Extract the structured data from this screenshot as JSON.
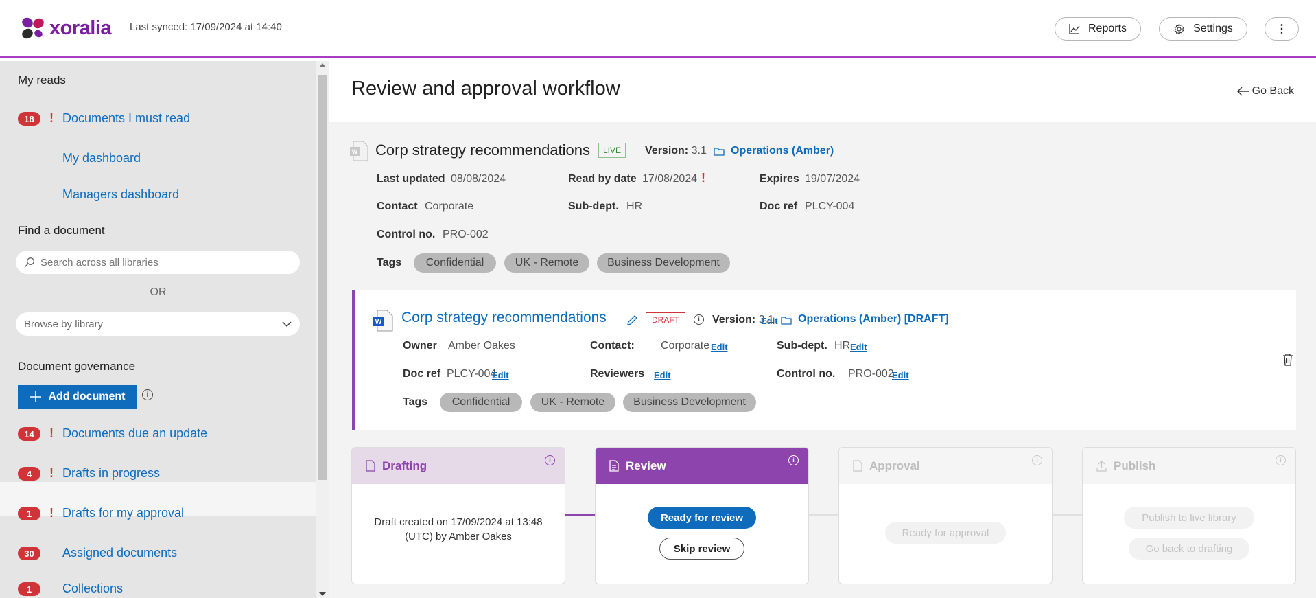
{
  "app": {
    "brand": "xoralia",
    "last_synced": "Last synced: 17/09/2024 at 14:40"
  },
  "header": {
    "reports_label": "Reports",
    "settings_label": "Settings",
    "more_label": "⋮"
  },
  "sidebar": {
    "my_reads_heading": "My reads",
    "documents_must_read": {
      "count": "18",
      "label": "Documents I must read"
    },
    "my_dashboard": "My dashboard",
    "managers_dashboard": "Managers dashboard",
    "find_heading": "Find a document",
    "search_placeholder": "Search across all libraries",
    "or_label": "OR",
    "browse_label": "Browse by library",
    "governance_heading": "Document governance",
    "add_document": "Add document",
    "items": [
      {
        "count": "14",
        "label": "Documents due an update",
        "alert": true
      },
      {
        "count": "4",
        "label": "Drafts in progress",
        "alert": true
      },
      {
        "count": "1",
        "label": "Drafts for my approval",
        "alert": true
      },
      {
        "count": "30",
        "label": "Assigned documents",
        "alert": false
      },
      {
        "count": "1",
        "label": "Collections",
        "alert": false
      }
    ]
  },
  "page": {
    "title": "Review and approval workflow",
    "go_back": "Go Back"
  },
  "live_doc": {
    "name": "Corp strategy recommendations",
    "status": "LIVE",
    "version_label": "Version:",
    "version": "3.1",
    "library": "Operations (Amber)",
    "last_updated_label": "Last updated",
    "last_updated": "08/08/2024",
    "read_by_label": "Read by date",
    "read_by": "17/08/2024",
    "expires_label": "Expires",
    "expires": "19/07/2024",
    "contact_label": "Contact",
    "contact": "Corporate",
    "subdept_label": "Sub-dept.",
    "subdept": "HR",
    "docref_label": "Doc ref",
    "docref": "PLCY-004",
    "control_label": "Control no.",
    "control": "PRO-002",
    "tags_label": "Tags",
    "tags": [
      "Confidential",
      "UK - Remote",
      "Business Development"
    ]
  },
  "draft_doc": {
    "name": "Corp strategy recommendations",
    "status": "DRAFT",
    "version_label": "Version:",
    "version": "3.1",
    "edit": "Edit",
    "library": "Operations (Amber) [DRAFT]",
    "owner_label": "Owner",
    "owner": "Amber Oakes",
    "contact_label": "Contact:",
    "contact": "Corporate",
    "subdept_label": "Sub-dept.",
    "subdept": "HR",
    "docref_label": "Doc ref",
    "docref": "PLCY-004",
    "reviewers_label": "Reviewers",
    "control_label": "Control no.",
    "control": "PRO-002",
    "tags_label": "Tags",
    "tags": [
      "Confidential",
      "UK - Remote",
      "Business Development"
    ]
  },
  "workflow": {
    "drafting": {
      "title": "Drafting",
      "text": "Draft created on 17/09/2024 at 13:48 (UTC) by Amber Oakes"
    },
    "review": {
      "title": "Review",
      "primary": "Ready for review",
      "secondary": "Skip review"
    },
    "approval": {
      "title": "Approval",
      "button": "Ready for approval"
    },
    "publish": {
      "title": "Publish",
      "primary": "Publish to live library",
      "secondary": "Go back to drafting"
    }
  },
  "colors": {
    "accent": "#a83cc5",
    "review": "#8e44ad",
    "link": "#0f6cbd",
    "badge": "#d13438"
  }
}
